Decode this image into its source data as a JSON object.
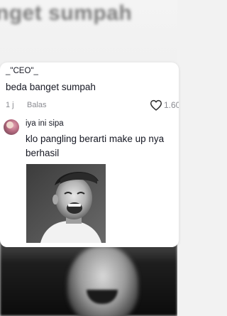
{
  "background": {
    "caption": "nget sumpah"
  },
  "comments": [
    {
      "username": "_\"CEO\"_",
      "text": "beda banget sumpah",
      "time": "1 j",
      "reply_label": "Balas",
      "like_count": "1.60"
    },
    {
      "username": "iya ini sipa",
      "text_lines": [
        "klo pangling berarti make up nya",
        "berhasil"
      ],
      "attachment": "photo"
    }
  ],
  "icons": {
    "like": "heart-outline-icon",
    "avatar": "user-avatar"
  },
  "colors": {
    "text_primary": "#161823",
    "text_secondary": "#8a8b91",
    "card_background": "#ffffff"
  }
}
